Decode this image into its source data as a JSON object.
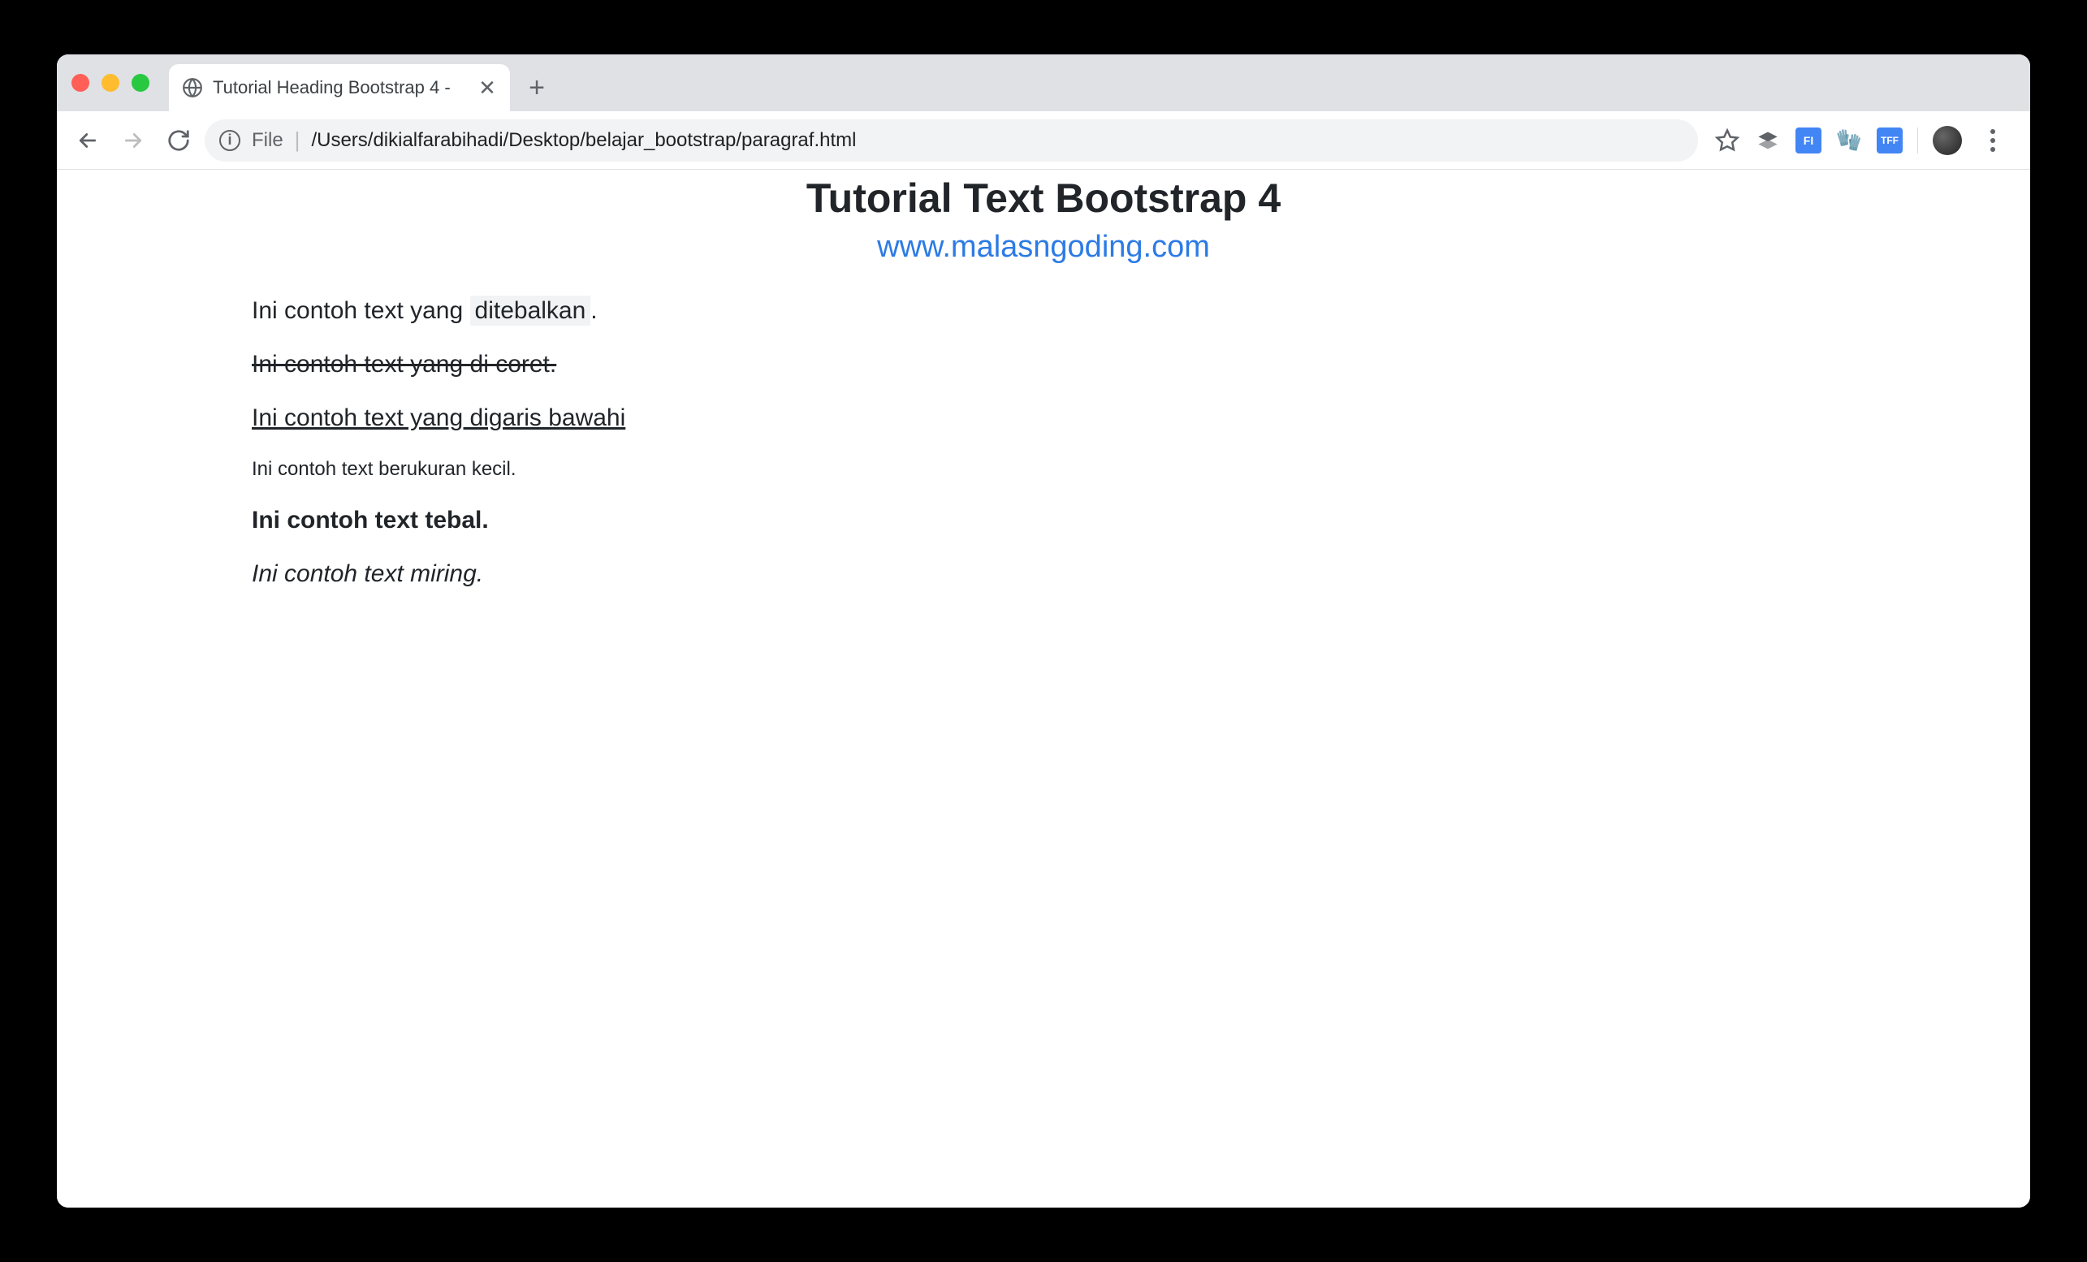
{
  "browser": {
    "tab_title": "Tutorial Heading Bootstrap 4 - ",
    "url_scheme": "File",
    "url_path": "/Users/dikialfarabihadi/Desktop/belajar_bootstrap/paragraf.html",
    "extensions": {
      "fi_label": "FI",
      "tff_label": "TFF"
    }
  },
  "page": {
    "heading": "Tutorial Text Bootstrap 4",
    "subheading": "www.malasngoding.com",
    "p1_prefix": "Ini contoh text yang ",
    "p1_mark": "ditebalkan",
    "p1_suffix": ".",
    "p2": "Ini contoh text yang di coret.",
    "p3": "Ini contoh text yang digaris bawahi",
    "p4": "Ini contoh text berukuran kecil.",
    "p5": "Ini contoh text tebal.",
    "p6": "Ini contoh text miring."
  }
}
